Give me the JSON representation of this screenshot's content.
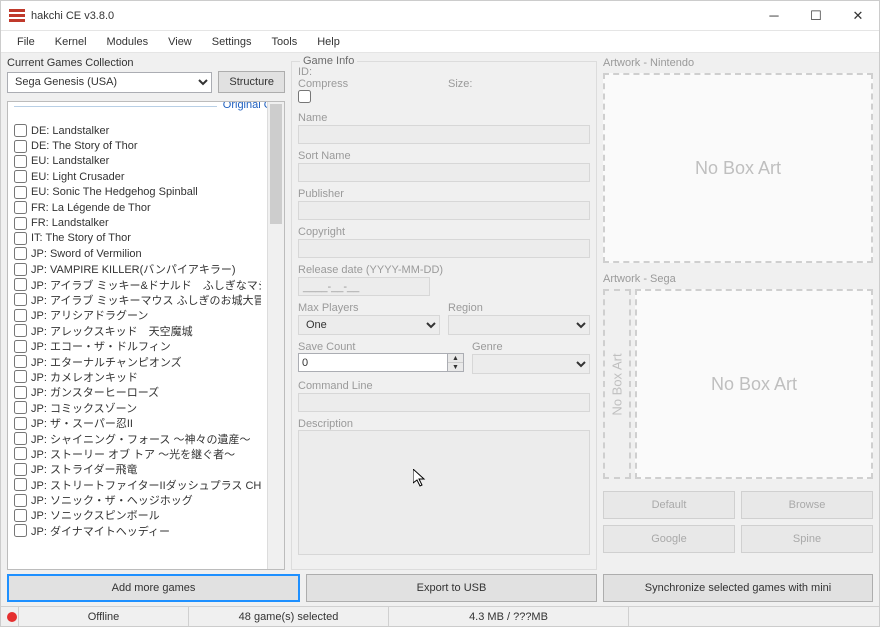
{
  "title": "hakchi CE v3.8.0",
  "menu": {
    "file": "File",
    "kernel": "Kernel",
    "modules": "Modules",
    "view": "View",
    "settings": "Settings",
    "tools": "Tools",
    "help": "Help"
  },
  "left": {
    "collection_label": "Current Games Collection",
    "collection_value": "Sega Genesis (USA)",
    "structure_btn": "Structure",
    "list_header": "Original Games",
    "games": [
      "DE: Landstalker",
      "DE: The Story of Thor",
      "EU: Landstalker",
      "EU: Light Crusader",
      "EU: Sonic The Hedgehog Spinball",
      "FR: La Légende de Thor",
      "FR: Landstalker",
      "IT: The Story of Thor",
      "JP: Sword of Vermilion",
      "JP: VAMPIRE KILLER(バンパイアキラー)",
      "JP: アイラブ ミッキー&ドナルド　ふしぎなマジックボッ…",
      "JP: アイラブ ミッキーマウス ふしぎのお城大冒険",
      "JP: アリシアドラグーン",
      "JP: アレックスキッド　天空魔城",
      "JP: エコー・ザ・ドルフィン",
      "JP: エターナルチャンピオンズ",
      "JP: カメレオンキッド",
      "JP: ガンスターヒーローズ",
      "JP: コミックスゾーン",
      "JP: ザ・スーパー忍II",
      "JP: シャイニング・フォース ～神々の遺産～",
      "JP: ストーリー オブ トア ～光を継ぐ者～",
      "JP: ストライダー飛竜",
      "JP: ストリートファイターIIダッシュプラス CHAMPION E…",
      "JP: ソニック・ザ・ヘッジホッグ",
      "JP: ソニックスピンボール",
      "JP: ダイナマイトヘッディー"
    ]
  },
  "info": {
    "header": "Game Info",
    "id": "ID:",
    "compress": "Compress",
    "size": "Size:",
    "name": "Name",
    "sortname": "Sort Name",
    "publisher": "Publisher",
    "copyright": "Copyright",
    "release": "Release date (YYYY-MM-DD)",
    "release_value": "____-__-__",
    "maxplayers": "Max Players",
    "maxplayers_value": "One",
    "region": "Region",
    "savecount": "Save Count",
    "savecount_value": "0",
    "genre": "Genre",
    "cmdline": "Command Line",
    "description": "Description"
  },
  "art": {
    "nin_label": "Artwork - Nintendo",
    "sega_label": "Artwork - Sega",
    "nobox": "No Box Art",
    "spine_text": "No Box Art",
    "default": "Default",
    "browse": "Browse",
    "google": "Google",
    "spine": "Spine"
  },
  "bottom": {
    "add": "Add more games",
    "export": "Export to USB",
    "sync": "Synchronize selected games with mini"
  },
  "status": {
    "offline": "Offline",
    "selected": "48 game(s) selected",
    "size": "4.3 MB / ???MB"
  }
}
